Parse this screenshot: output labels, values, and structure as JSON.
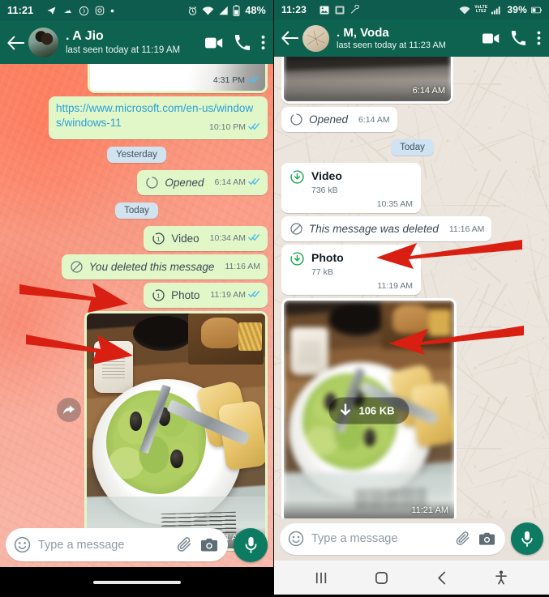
{
  "app": {
    "name": "WhatsApp",
    "accent": "#0d6350",
    "accent_dark": "#0d5c4d",
    "outgoing_bubble": "#e2f7c8",
    "incoming_bubble": "#ffffff"
  },
  "left_phone": {
    "status_bar": {
      "time": "11:21",
      "left_icons": [
        "telegram-icon",
        "weather-icon",
        "opera-icon",
        "instagram-icon",
        "dot-icon"
      ],
      "right_icons": [
        "alarm-icon",
        "wifi-icon",
        "signal-icon",
        "battery-icon"
      ],
      "battery_percent": "48%"
    },
    "header": {
      "back": "back-arrow",
      "avatar": "contact-avatar",
      "title": ". A Jio",
      "subtitle": "last seen today at 11:19 AM",
      "actions": [
        "video-call-icon",
        "voice-call-icon",
        "overflow-menu-icon"
      ]
    },
    "messages": [
      {
        "kind": "image_partial",
        "side": "out",
        "time": "4:31 PM",
        "ticks": "read"
      },
      {
        "kind": "text",
        "side": "out",
        "text": "https://www.microsoft.com/en-us/windows/windows-11",
        "is_link": true,
        "time": "10:10 PM",
        "ticks": "read"
      },
      {
        "kind": "daypill",
        "label": "Yesterday"
      },
      {
        "kind": "status",
        "side": "out",
        "icon": "view-once-opened-icon",
        "label": "Opened",
        "time": "6:14 AM",
        "ticks": "read"
      },
      {
        "kind": "daypill",
        "label": "Today"
      },
      {
        "kind": "status",
        "side": "out",
        "icon": "view-once-icon",
        "label": "Video",
        "time": "10:34 AM",
        "ticks": "read"
      },
      {
        "kind": "status",
        "side": "out",
        "icon": "deleted-icon",
        "label": "You deleted this message",
        "time": "11:16 AM",
        "ticks": "none"
      },
      {
        "kind": "status",
        "side": "out",
        "icon": "view-once-icon",
        "label": "Photo",
        "time": "11:19 AM",
        "ticks": "read"
      },
      {
        "kind": "image",
        "side": "out",
        "time": "11:21 AM",
        "ticks": "read",
        "forward_button": "forward-icon"
      }
    ],
    "input": {
      "emoji": "emoji-icon",
      "placeholder": "Type a message",
      "attach": "attach-icon",
      "camera": "camera-icon",
      "mic": "mic-icon"
    },
    "nav": {
      "style": "gesture"
    }
  },
  "right_phone": {
    "status_bar": {
      "time": "11:23",
      "left_icons": [
        "image-icon",
        "screenshot-icon",
        "tools-icon"
      ],
      "right_icons": [
        "wifi-icon",
        "volte-icon",
        "signal-icon",
        "battery-icon"
      ],
      "volte_label_top": "VoLTE",
      "volte_label_bottom": "LTE2",
      "battery_percent": "39%"
    },
    "header": {
      "back": "back-arrow",
      "avatar": "contact-avatar",
      "title": ". M, Voda",
      "subtitle": "last seen today at 11:23 AM",
      "actions": [
        "video-call-icon",
        "voice-call-icon",
        "overflow-menu-icon"
      ]
    },
    "messages": [
      {
        "kind": "image_partial",
        "side": "in",
        "time": "6:14 AM"
      },
      {
        "kind": "status",
        "side": "in",
        "icon": "view-once-opened-icon",
        "label": "Opened",
        "time": "6:14 AM"
      },
      {
        "kind": "daypill",
        "label": "Today"
      },
      {
        "kind": "file",
        "side": "in",
        "icon": "download-view-once-icon",
        "name": "Video",
        "size": "736 kB",
        "time": "10:35 AM"
      },
      {
        "kind": "status",
        "side": "in",
        "icon": "deleted-icon",
        "label": "This message was deleted",
        "time": "11:16 AM"
      },
      {
        "kind": "file",
        "side": "in",
        "icon": "download-view-once-icon",
        "name": "Photo",
        "size": "77 kB",
        "time": "11:19 AM"
      },
      {
        "kind": "image_download",
        "side": "in",
        "download_label": "106 KB",
        "time": "11:21 AM"
      }
    ],
    "input": {
      "emoji": "emoji-icon",
      "placeholder": "Type a message",
      "attach": "attach-icon",
      "camera": "camera-icon",
      "mic": "mic-icon"
    },
    "nav": {
      "style": "keys",
      "keys": [
        "recents-key",
        "home-key",
        "back-key",
        "accessibility-key"
      ]
    }
  },
  "annotations": {
    "arrows": [
      {
        "target": "left-video-bubble",
        "color": "#d91f11"
      },
      {
        "target": "left-photo-bubble",
        "color": "#d91f11"
      },
      {
        "target": "right-video-card",
        "color": "#d91f11"
      },
      {
        "target": "right-photo-card",
        "color": "#d91f11"
      }
    ],
    "color": "#d91f11"
  }
}
